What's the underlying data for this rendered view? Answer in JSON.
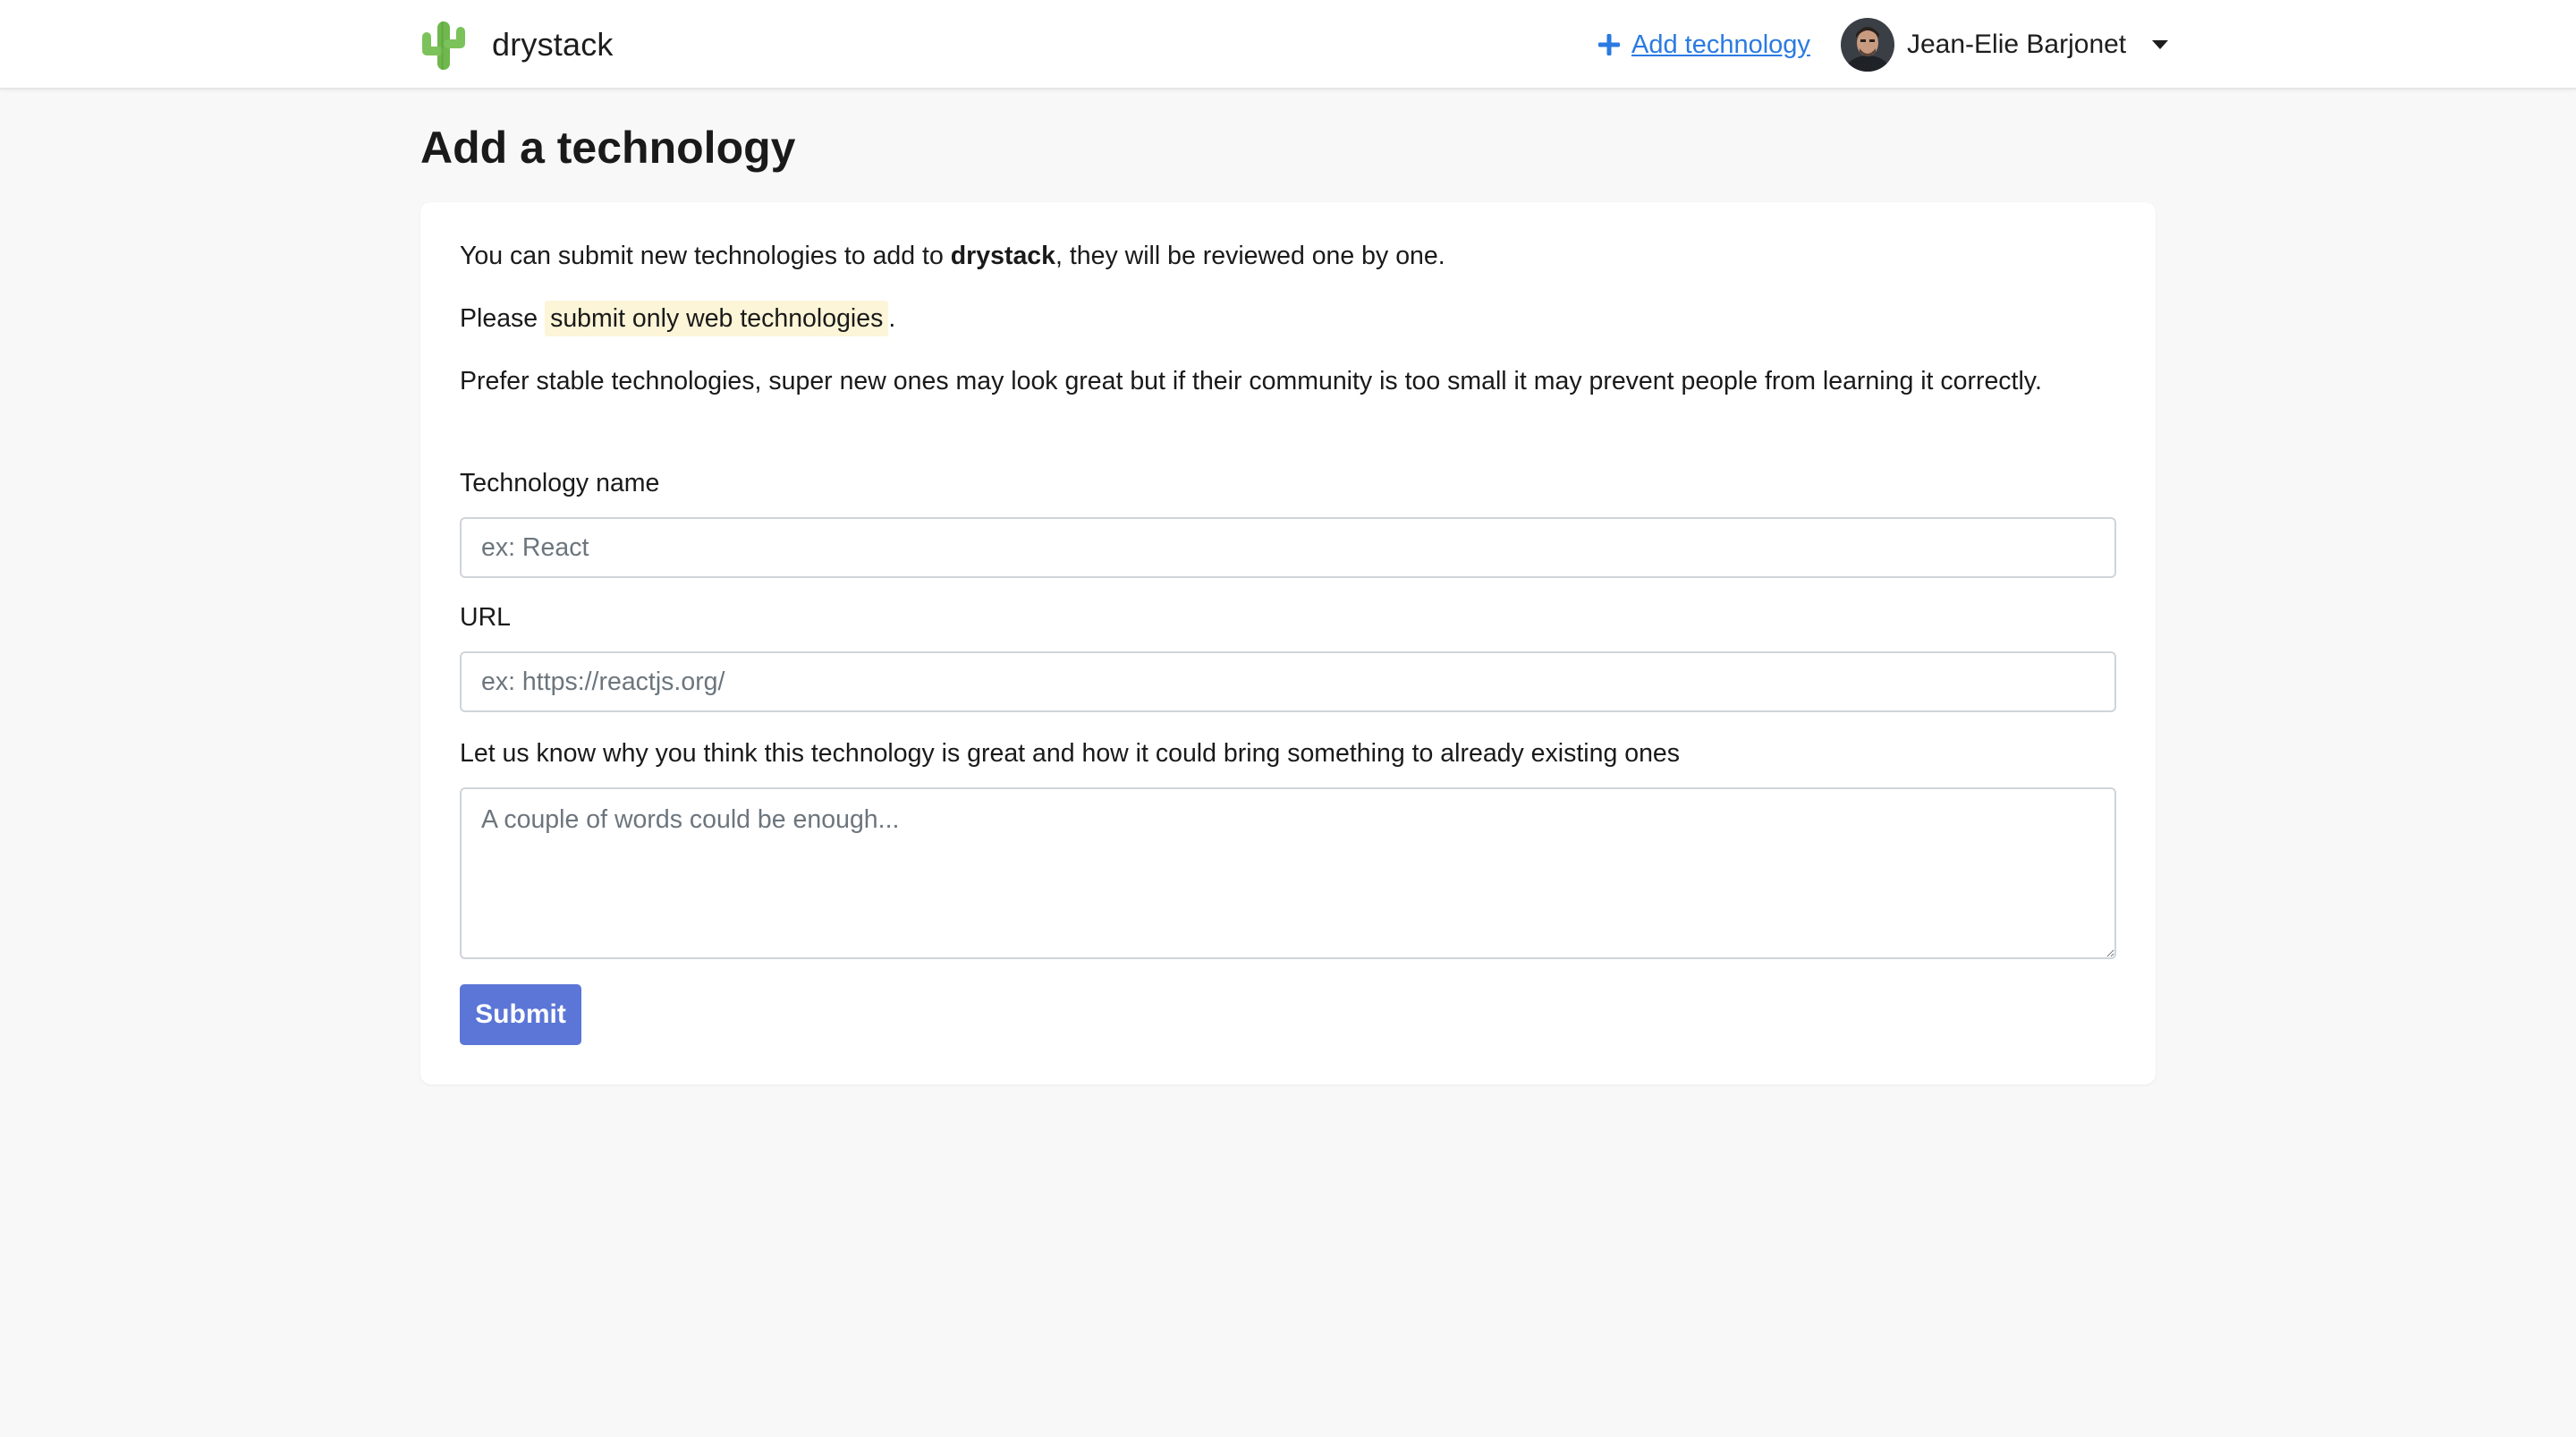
{
  "header": {
    "brand_name": "drystack",
    "add_link_label": "Add technology",
    "user_name": "Jean-Elie Barjonet",
    "icons": {
      "brand": "cactus-icon",
      "add": "plus-icon",
      "menu": "caret-down-icon"
    }
  },
  "page": {
    "title": "Add a technology"
  },
  "intro": {
    "p1_before": "You can submit new technologies to add to ",
    "p1_brand": "drystack",
    "p1_after": ", they will be reviewed one by one.",
    "p2_before": "Please ",
    "p2_highlight": "submit only web technologies",
    "p2_after": ".",
    "p3": "Prefer stable technologies, super new ones may look great but if their community is too small it may prevent people from learning it correctly."
  },
  "form": {
    "name_label": "Technology name",
    "name_value": "",
    "name_placeholder": "ex: React",
    "url_label": "URL",
    "url_value": "",
    "url_placeholder": "ex: https://reactjs.org/",
    "why_label": "Let us know why you think this technology is great and how it could bring something to already existing ones",
    "why_value": "",
    "why_placeholder": "A couple of words could be enough...",
    "submit_label": "Submit"
  },
  "colors": {
    "link": "#2a7ae2",
    "submit": "#5b76d6",
    "highlight": "#fdf5d8",
    "cactus": "#6fb84d"
  }
}
